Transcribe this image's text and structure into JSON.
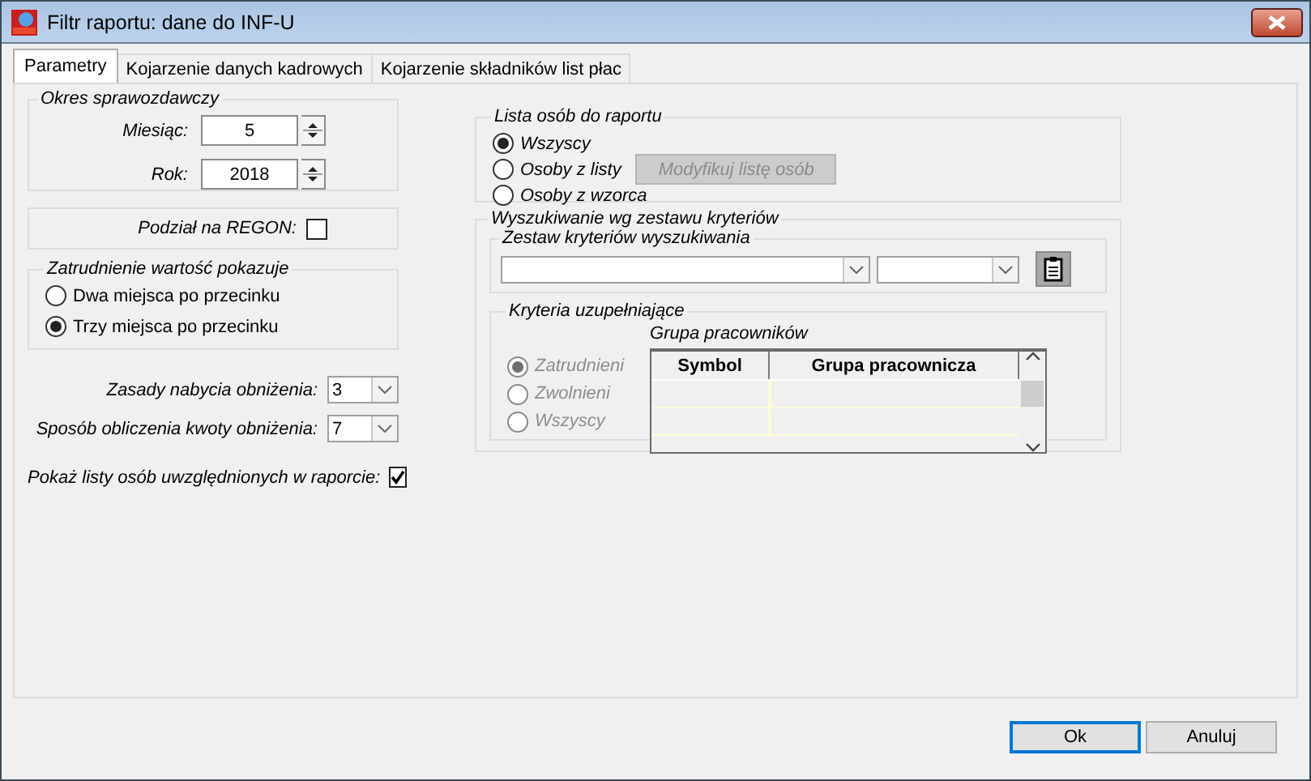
{
  "window": {
    "title": "Filtr raportu: dane do INF-U"
  },
  "tabs": [
    {
      "label": "Parametry",
      "selected": true
    },
    {
      "label": "Kojarzenie danych kadrowych",
      "selected": false
    },
    {
      "label": "Kojarzenie składników list płac",
      "selected": false
    }
  ],
  "period": {
    "legend": "Okres sprawozdawczy",
    "fields": [
      {
        "label": "Miesiąc:",
        "value": "5"
      },
      {
        "label": "Rok:",
        "value": "2018"
      }
    ]
  },
  "regon": {
    "label": "Podział na REGON:",
    "checked": false
  },
  "employment": {
    "legend": "Zatrudnienie wartość pokazuje",
    "options": [
      {
        "label": "Dwa miejsca po przecinku",
        "selected": false
      },
      {
        "label": "Trzy miejsca po przecinku",
        "selected": true
      }
    ]
  },
  "combos": [
    {
      "label": "Zasady nabycia obniżenia:",
      "value": "3"
    },
    {
      "label": "Sposób obliczenia kwoty obniżenia:",
      "value": "7"
    }
  ],
  "show_lists": {
    "label": "Pokaż listy osób uwzględnionych w raporcie:",
    "checked": true
  },
  "persons": {
    "legend": "Lista osób do raportu",
    "options": [
      {
        "label": "Wszyscy",
        "selected": true
      },
      {
        "label": "Osoby z listy",
        "selected": false
      },
      {
        "label": "Osoby z wzorca",
        "selected": false
      }
    ],
    "button": {
      "label": "Modyfikuj listę osób",
      "disabled": true
    }
  },
  "search": {
    "legend": "Wyszukiwanie wg zestawu kryteriów",
    "set": {
      "legend": "Zestaw kryteriów wyszukiwania"
    },
    "extra": {
      "legend": "Kryteria uzupełniające",
      "options": [
        {
          "label": "Zatrudnieni",
          "selected": true,
          "disabled": true
        },
        {
          "label": "Zwolnieni",
          "selected": false,
          "disabled": true
        },
        {
          "label": "Wszyscy",
          "selected": false,
          "disabled": true
        }
      ],
      "grid": {
        "title": "Grupa pracowników",
        "columns": [
          "Symbol",
          "Grupa pracownicza"
        ]
      }
    }
  },
  "buttons": [
    {
      "label": "Ok",
      "default": true
    },
    {
      "label": "Anuluj",
      "default": false
    }
  ]
}
